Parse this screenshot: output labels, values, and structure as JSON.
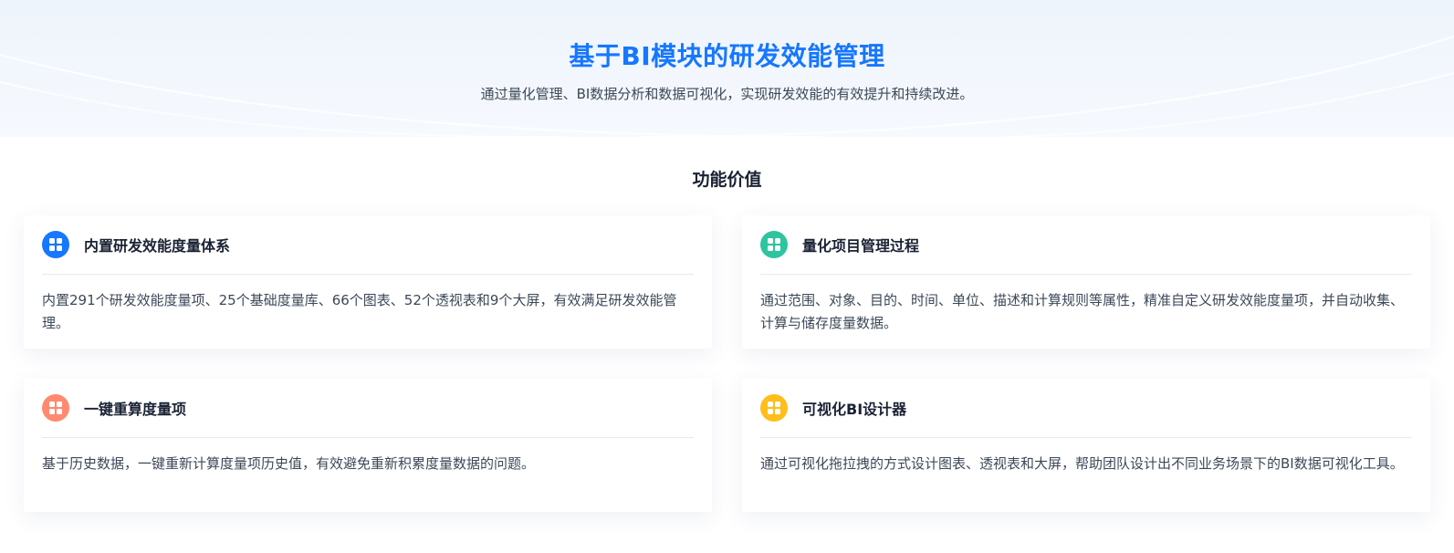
{
  "hero": {
    "title": "基于BI模块的研发效能管理",
    "subtitle": "通过量化管理、BI数据分析和数据可视化，实现研发效能的有效提升和持续改进。"
  },
  "section": {
    "title": "功能价值"
  },
  "cards": [
    {
      "title": "内置研发效能度量体系",
      "description": "内置291个研发效能度量项、25个基础度量库、66个图表、52个透视表和9个大屏，有效满足研发效能管理。",
      "icon": "grid-icon",
      "color": "#1677ff"
    },
    {
      "title": "量化项目管理过程",
      "description": "通过范围、对象、目的、时间、单位、描述和计算规则等属性，精准自定义研发效能度量项，并自动收集、计算与储存度量数据。",
      "icon": "grid-icon",
      "color": "#2ec4a0"
    },
    {
      "title": "一键重算度量项",
      "description": "基于历史数据，一键重新计算度量项历史值，有效避免重新积累度量数据的问题。",
      "icon": "grid-icon",
      "color": "#ff8a70"
    },
    {
      "title": "可视化BI设计器",
      "description": "通过可视化拖拉拽的方式设计图表、透视表和大屏，帮助团队设计出不同业务场景下的BI数据可视化工具。",
      "icon": "grid-icon",
      "color": "#ffbe1a"
    }
  ]
}
